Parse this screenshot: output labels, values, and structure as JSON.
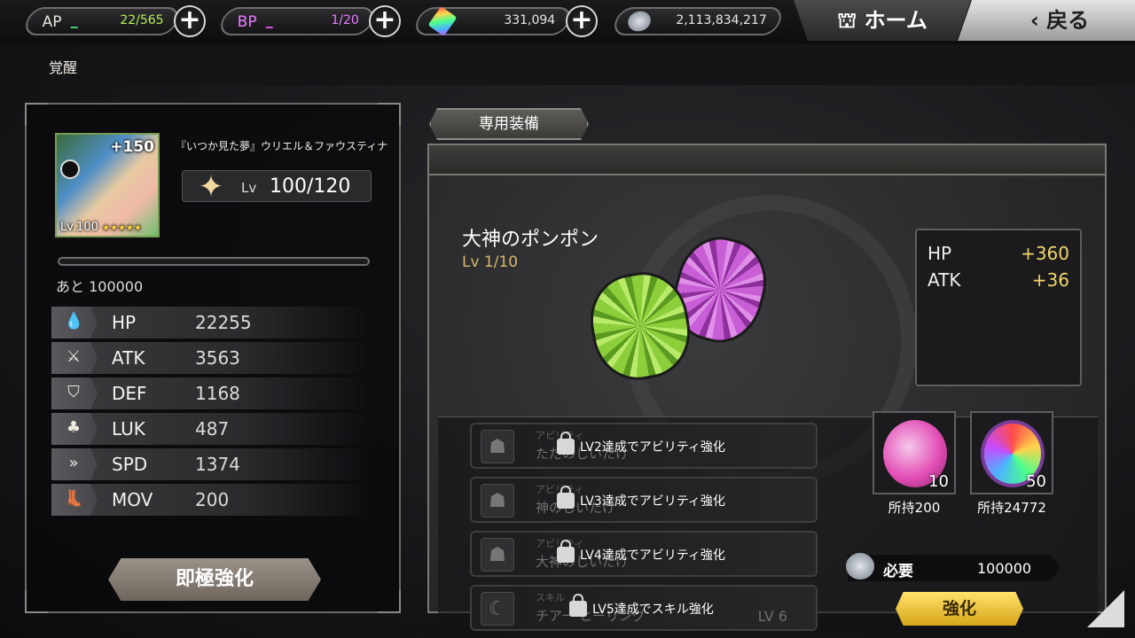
{
  "topbar": {
    "ap": {
      "label": "AP",
      "value": "22/565"
    },
    "bp": {
      "label": "BP",
      "value": "1/20"
    },
    "gems": {
      "value": "331,094"
    },
    "coins": {
      "value": "2,113,834,217"
    },
    "home_label": "ホーム",
    "back_label": "戻る"
  },
  "page": {
    "subtitle": "覚醒"
  },
  "character": {
    "name": "『いつか見た夢』ウリエル＆ファウスティナ",
    "plus": "+150",
    "level_badge": "Lv.100",
    "stars": "★★★★★",
    "lv_label": "Lv",
    "lv_value": "100/120",
    "remaining": "あと 100000",
    "stats": [
      {
        "name": "HP",
        "value": "22255",
        "icon": "drop-icon"
      },
      {
        "name": "ATK",
        "value": "3563",
        "icon": "sword-icon"
      },
      {
        "name": "DEF",
        "value": "1168",
        "icon": "shield-icon"
      },
      {
        "name": "LUK",
        "value": "487",
        "icon": "clover-icon"
      },
      {
        "name": "SPD",
        "value": "1374",
        "icon": "double-chevron-icon"
      },
      {
        "name": "MOV",
        "value": "200",
        "icon": "boot-icon"
      }
    ],
    "instant_button": "即極強化"
  },
  "equipment": {
    "tab_label": "専用装備",
    "name": "大神のポンポン",
    "level": "Lv 1/10",
    "bonuses": [
      {
        "name": "HP",
        "value": "+360"
      },
      {
        "name": "ATK",
        "value": "+36"
      }
    ],
    "abilities": [
      {
        "type": "アビリティ",
        "title": "ただのしいたけ",
        "lock_text": "LV2達成でアビリティ強化",
        "level": ""
      },
      {
        "type": "アビリティ",
        "title": "神のしいたけ",
        "lock_text": "LV3達成でアビリティ強化",
        "level": ""
      },
      {
        "type": "アビリティ",
        "title": "大神のしいたけ",
        "lock_text": "LV4達成でアビリティ強化",
        "level": ""
      },
      {
        "type": "スキル",
        "title": "チアー ヒーリング",
        "lock_text": "LV5達成でスキル強化",
        "level": "LV 6"
      }
    ],
    "materials": [
      {
        "qty": "10",
        "owned": "所持200"
      },
      {
        "qty": "50",
        "owned": "所持24772"
      }
    ],
    "required_label": "必要",
    "required_value": "100000",
    "enhance_button": "強化"
  }
}
